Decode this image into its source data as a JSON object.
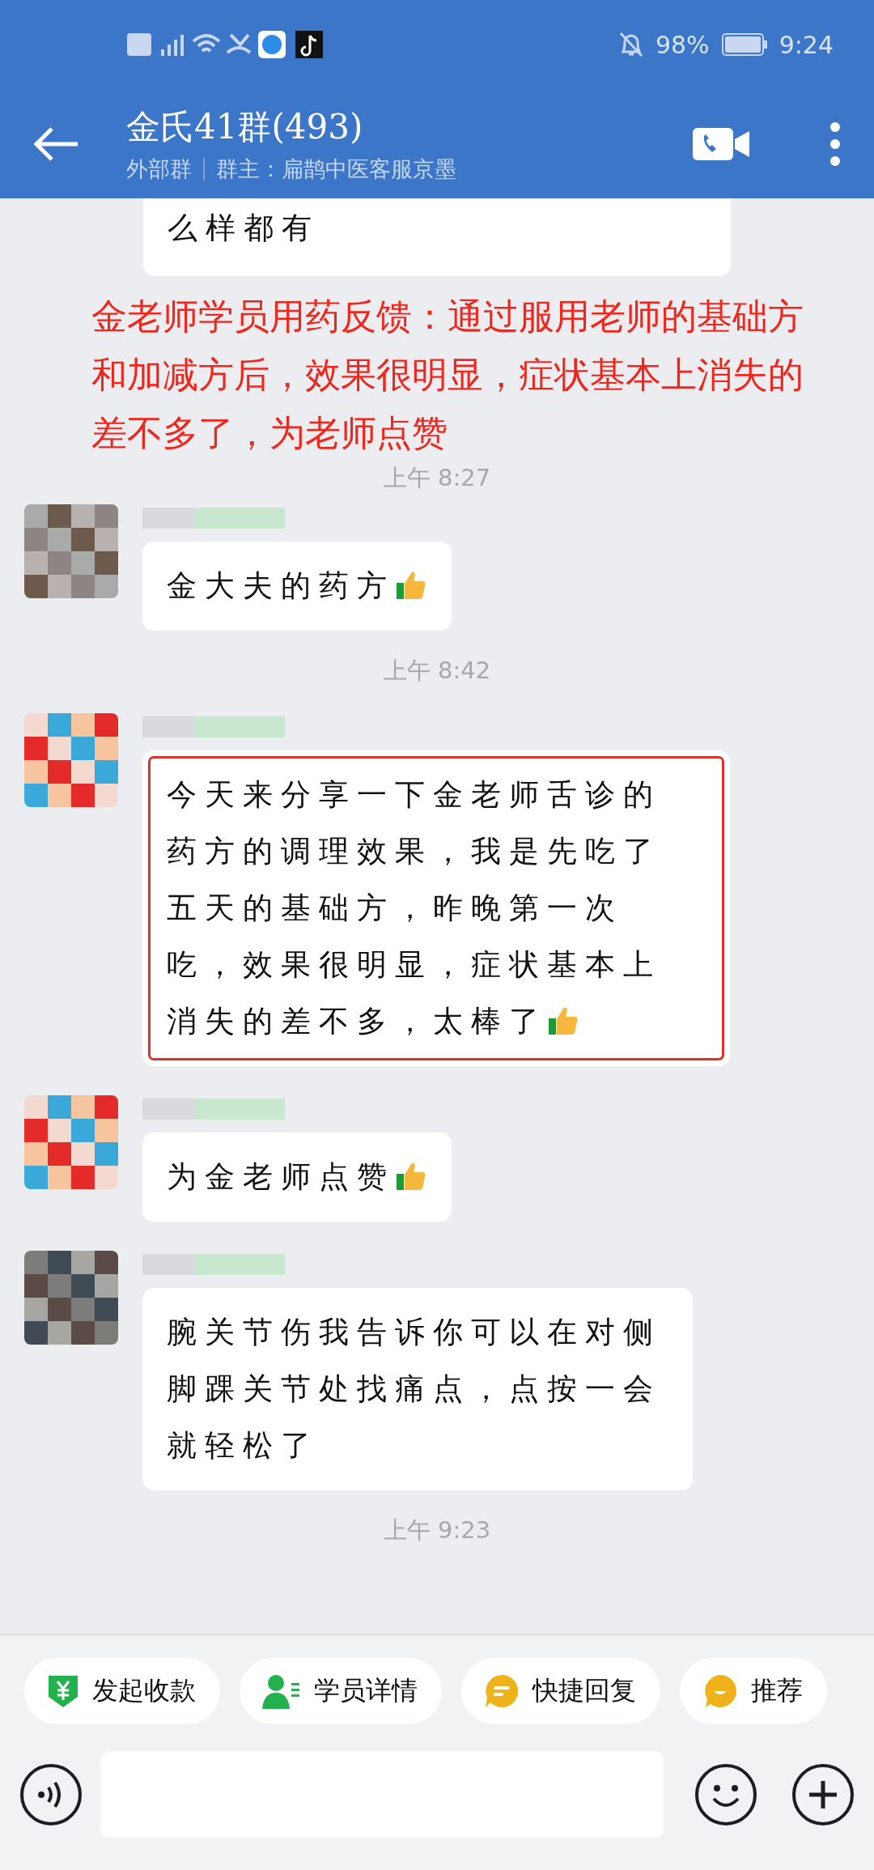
{
  "status_bar": {
    "battery": "98%",
    "time": "9:24"
  },
  "header": {
    "title": "金氏41群(493)",
    "tag": "外部群",
    "owner": "群主：扁鹊中医客服京墨"
  },
  "messages": [
    {
      "kind": "bubble",
      "text": "么样都有",
      "highlighted": false
    },
    {
      "kind": "annotation",
      "text": "金老师学员用药反馈：通过服用老师的基础方和加减方后，效果很明显，症状基本上消失的差不多了，为老师点赞"
    },
    {
      "kind": "time",
      "text": "上午 8:27"
    },
    {
      "kind": "message",
      "text": "金大夫的药方",
      "highlighted": false
    },
    {
      "kind": "time",
      "text": "上午 8:42"
    },
    {
      "kind": "message",
      "text": "今天来分享一下金老师舌诊的药方的调理效果，我是先吃了五天的基础方，昨晚第一次吃，效果很明显，症状基本上消失的差不多，太棒了",
      "highlighted": true
    },
    {
      "kind": "message",
      "text": "为金老师点赞",
      "highlighted": false
    },
    {
      "kind": "message",
      "text": "腕关节伤我告诉你可以在对侧脚踝关节处找痛点，点按一会就轻松了",
      "highlighted": false
    },
    {
      "kind": "time",
      "text": "上午 9:23"
    }
  ],
  "quick_actions": [
    {
      "label": "发起收款"
    },
    {
      "label": "学员详情"
    },
    {
      "label": "快捷回复"
    },
    {
      "label": "推荐"
    }
  ]
}
